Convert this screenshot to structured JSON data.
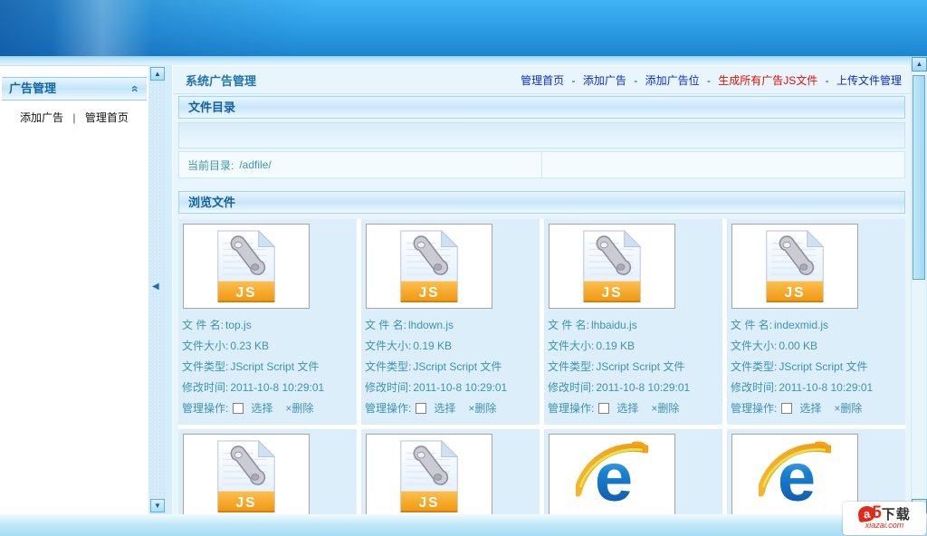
{
  "sidebar": {
    "title": "广告管理",
    "items": [
      {
        "label": "添加广告"
      },
      {
        "label": "管理首页"
      }
    ],
    "item_separator": "|"
  },
  "main": {
    "title": "系统广告管理",
    "nav": {
      "separator": "-",
      "links": [
        {
          "label": "管理首页"
        },
        {
          "label": "添加广告"
        },
        {
          "label": "添加广告位"
        },
        {
          "label": "生成所有广告JS文件"
        },
        {
          "label": "上传文件管理"
        }
      ]
    },
    "directory_section": {
      "title": "文件目录",
      "current_dir_label": "当前目录:",
      "current_dir_value": "/adfile/"
    },
    "browse_section": {
      "title": "浏览文件",
      "field_labels": {
        "name": "文 件 名:",
        "size": "文件大小:",
        "type": "文件类型:",
        "modified": "修改时间:",
        "actions": "管理操作:"
      },
      "select_label": "选择",
      "delete_label": "×删除",
      "files": [
        {
          "icon": "js",
          "name": "top.js",
          "size": "0.23 KB",
          "type": "JScript Script 文件",
          "modified": "2011-10-8 10:29:01"
        },
        {
          "icon": "js",
          "name": "lhdown.js",
          "size": "0.19 KB",
          "type": "JScript Script 文件",
          "modified": "2011-10-8 10:29:01"
        },
        {
          "icon": "js",
          "name": "lhbaidu.js",
          "size": "0.19 KB",
          "type": "JScript Script 文件",
          "modified": "2011-10-8 10:29:01"
        },
        {
          "icon": "js",
          "name": "indexmid.js",
          "size": "0.00 KB",
          "type": "JScript Script 文件",
          "modified": "2011-10-8 10:29:01"
        }
      ],
      "partial_row_icons": [
        {
          "icon": "js"
        },
        {
          "icon": "js"
        },
        {
          "icon": "ie"
        },
        {
          "icon": "ie"
        }
      ]
    }
  },
  "icons": {
    "js_badge": "JS",
    "ie_glyph": "e"
  },
  "watermark": {
    "brand_a": "a",
    "brand_number": "5",
    "brand_text": "下载",
    "brand_domain": "xiazai.com"
  },
  "colors": {
    "nav_link": "#0a2ec9",
    "nav_link_highlight": "#e00d00",
    "detail_text": "#3e93b2",
    "section_title": "#14619e",
    "header_blue_top": "#3fb3f4",
    "header_blue_bottom": "#1d85d0",
    "js_badge_orange": "#f5a31e"
  }
}
